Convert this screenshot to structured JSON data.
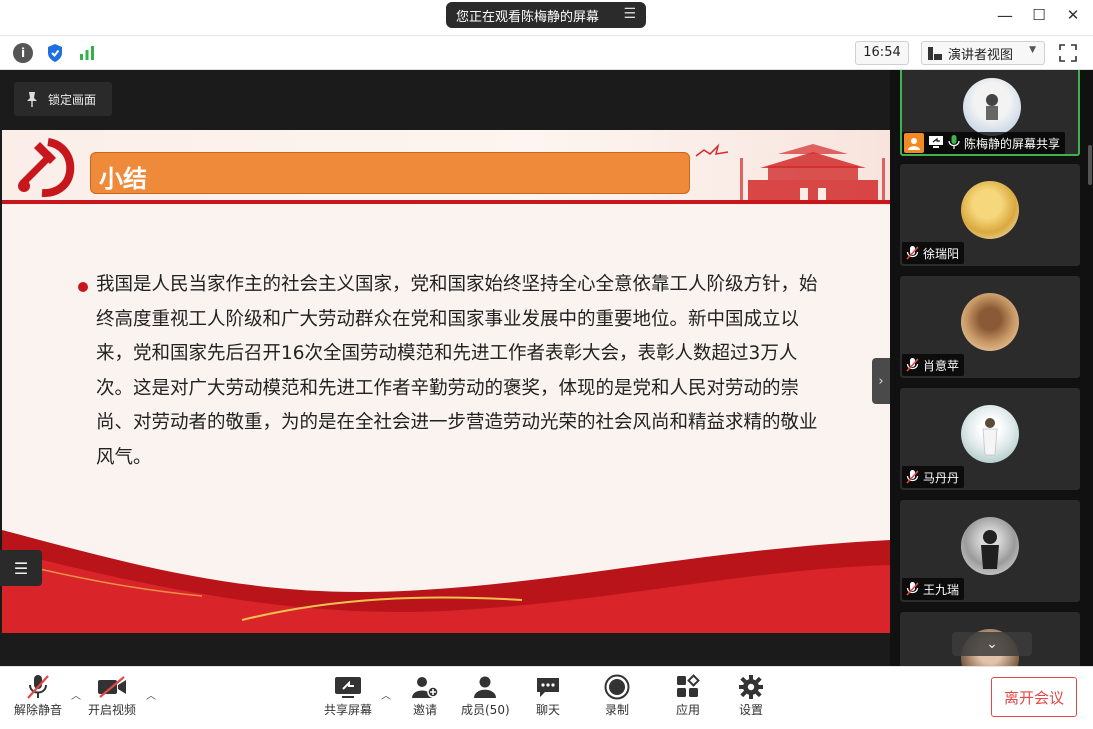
{
  "titlebar": {
    "viewing_label": "您正在观看陈梅静的屏幕",
    "minimize": "—",
    "maximize": "☐",
    "close": "✕"
  },
  "infobar": {
    "info_icon": "info-icon",
    "shield_icon": "shield-icon",
    "signal_icon": "signal-icon",
    "time": "16:54",
    "view_mode": "演讲者视图"
  },
  "share": {
    "lock_label": "锁定画面",
    "slide_title": "小结",
    "slide_body": "我国是人民当家作主的社会主义国家，党和国家始终坚持全心全意依靠工人阶级方针，始终高度重视工人阶级和广大劳动群众在党和国家事业发展中的重要地位。新中国成立以来，党和国家先后召开16次全国劳动模范和先进工作者表彰大会，表彰人数超过3万人次。这是对广大劳动模范和先进工作者辛勤劳动的褒奖，体现的是党和人民对劳动的崇尚、对劳动者的敬重，为的是在全社会进一步营造劳动光荣的社会风尚和精益求精的敬业风气。"
  },
  "participants": [
    {
      "name": "陈梅静的屏幕共享",
      "sharing": true
    },
    {
      "name": "徐瑞阳",
      "sharing": false
    },
    {
      "name": "肖意苹",
      "sharing": false
    },
    {
      "name": "马丹丹",
      "sharing": false
    },
    {
      "name": "王九瑞",
      "sharing": false
    }
  ],
  "toolbar": {
    "unmute": "解除静音",
    "start_video": "开启视频",
    "share_screen": "共享屏幕",
    "invite": "邀请",
    "members": "成员(50)",
    "chat": "聊天",
    "record": "录制",
    "apps": "应用",
    "settings": "设置",
    "leave": "离开会议"
  },
  "colors": {
    "accent_red": "#c8161d",
    "title_orange": "#ee8a39",
    "leave_red": "#e24848",
    "active_green": "#3fb24f"
  }
}
